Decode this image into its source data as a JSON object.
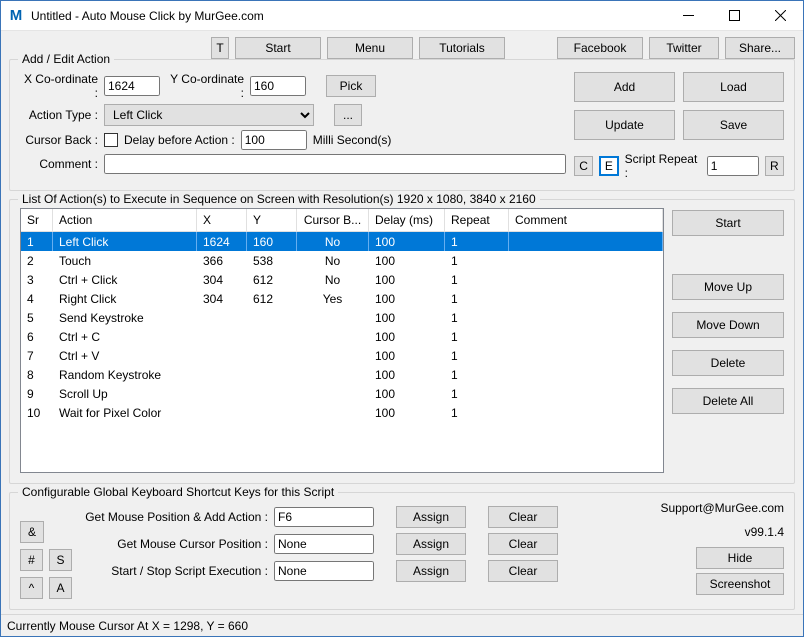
{
  "window": {
    "title": "Untitled - Auto Mouse Click by MurGee.com"
  },
  "topbar": {
    "t": "T",
    "start": "Start",
    "menu": "Menu",
    "tutorials": "Tutorials",
    "facebook": "Facebook",
    "twitter": "Twitter",
    "share": "Share..."
  },
  "addedit": {
    "legend": "Add / Edit Action",
    "x_label": "X Co-ordinate :",
    "x_value": "1624",
    "y_label": "Y Co-ordinate :",
    "y_value": "160",
    "pick": "Pick",
    "action_type_label": "Action Type :",
    "action_type_value": "Left Click",
    "ellipsis": "...",
    "cursor_back_label": "Cursor Back :",
    "delay_label": "Delay before Action :",
    "delay_value": "100",
    "delay_unit": "Milli Second(s)",
    "comment_label": "Comment :",
    "comment_value": "",
    "add": "Add",
    "load": "Load",
    "update": "Update",
    "save": "Save",
    "c": "C",
    "e": "E",
    "script_repeat_label": "Script Repeat :",
    "script_repeat_value": "1",
    "r": "R"
  },
  "list": {
    "legend": "List Of Action(s) to Execute in Sequence on Screen with Resolution(s) 1920 x 1080, 3840 x 2160",
    "headers": {
      "sr": "Sr",
      "action": "Action",
      "x": "X",
      "y": "Y",
      "cb": "Cursor B...",
      "delay": "Delay (ms)",
      "repeat": "Repeat",
      "comment": "Comment"
    },
    "rows": [
      {
        "sr": "1",
        "action": "Left Click",
        "x": "1624",
        "y": "160",
        "cb": "No",
        "delay": "100",
        "repeat": "1",
        "comment": "",
        "selected": true
      },
      {
        "sr": "2",
        "action": "Touch",
        "x": "366",
        "y": "538",
        "cb": "No",
        "delay": "100",
        "repeat": "1",
        "comment": ""
      },
      {
        "sr": "3",
        "action": "Ctrl + Click",
        "x": "304",
        "y": "612",
        "cb": "No",
        "delay": "100",
        "repeat": "1",
        "comment": ""
      },
      {
        "sr": "4",
        "action": "Right Click",
        "x": "304",
        "y": "612",
        "cb": "Yes",
        "delay": "100",
        "repeat": "1",
        "comment": ""
      },
      {
        "sr": "5",
        "action": "Send Keystroke",
        "x": "",
        "y": "",
        "cb": "",
        "delay": "100",
        "repeat": "1",
        "comment": ""
      },
      {
        "sr": "6",
        "action": "Ctrl + C",
        "x": "",
        "y": "",
        "cb": "",
        "delay": "100",
        "repeat": "1",
        "comment": ""
      },
      {
        "sr": "7",
        "action": "Ctrl + V",
        "x": "",
        "y": "",
        "cb": "",
        "delay": "100",
        "repeat": "1",
        "comment": ""
      },
      {
        "sr": "8",
        "action": "Random Keystroke",
        "x": "",
        "y": "",
        "cb": "",
        "delay": "100",
        "repeat": "1",
        "comment": ""
      },
      {
        "sr": "9",
        "action": "Scroll Up",
        "x": "",
        "y": "",
        "cb": "",
        "delay": "100",
        "repeat": "1",
        "comment": ""
      },
      {
        "sr": "10",
        "action": "Wait for Pixel Color",
        "x": "",
        "y": "",
        "cb": "",
        "delay": "100",
        "repeat": "1",
        "comment": ""
      }
    ],
    "side": {
      "start": "Start",
      "moveup": "Move Up",
      "movedown": "Move Down",
      "delete": "Delete",
      "deleteall": "Delete All"
    }
  },
  "shortcuts": {
    "legend": "Configurable Global Keyboard Shortcut Keys for this Script",
    "amp": "&",
    "hash": "#",
    "s": "S",
    "caret": "^",
    "a": "A",
    "row1_label": "Get Mouse Position & Add Action :",
    "row1_value": "F6",
    "row2_label": "Get Mouse Cursor Position :",
    "row2_value": "None",
    "row3_label": "Start / Stop Script Execution :",
    "row3_value": "None",
    "assign": "Assign",
    "clear": "Clear",
    "support": "Support@MurGee.com",
    "version": "v99.1.4",
    "hide": "Hide",
    "screenshot": "Screenshot"
  },
  "status": {
    "text": "Currently Mouse Cursor At X = 1298, Y = 660"
  }
}
